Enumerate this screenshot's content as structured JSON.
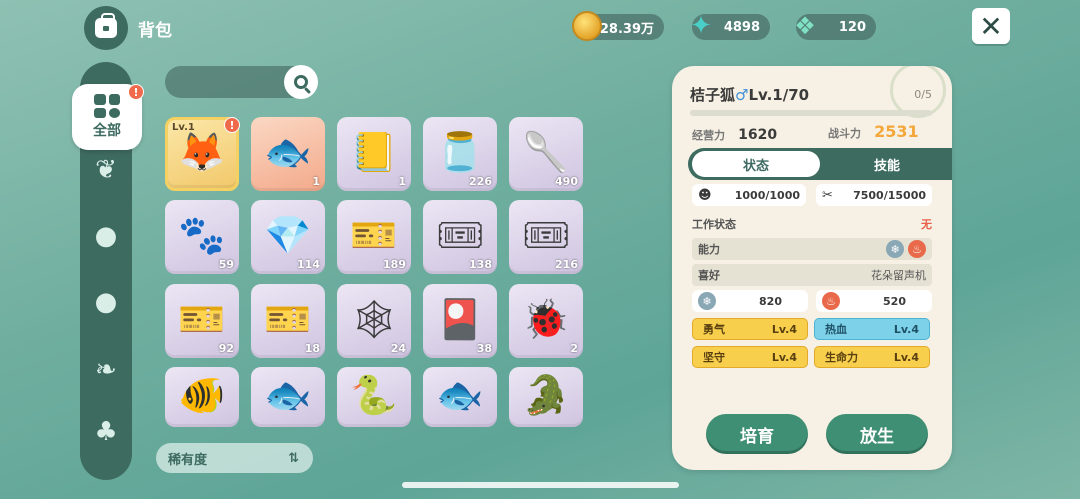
{
  "header": {
    "title": "背包",
    "currencies": [
      {
        "icon": "gold-coin-icon",
        "value": "28.39万"
      },
      {
        "icon": "blue-star-icon",
        "value": "4898"
      },
      {
        "icon": "green-gem-icon",
        "value": "120"
      }
    ],
    "close_icon": "✕"
  },
  "sidebar": {
    "active_label": "全部",
    "badge": "!",
    "items": [
      {
        "name": "sprout-icon",
        "glyph": "🌱"
      },
      {
        "name": "round-creature-icon",
        "glyph": "●"
      },
      {
        "name": "round-creature-icon-2",
        "glyph": "●"
      },
      {
        "name": "leaf-icon",
        "glyph": "🍃"
      },
      {
        "name": "tree-icon",
        "glyph": "🌳"
      }
    ]
  },
  "search": {
    "placeholder": ""
  },
  "grid": {
    "items": [
      {
        "name": "orange-fox-pet",
        "count": "",
        "level": "Lv.1",
        "badge": "!",
        "glyph": "🦊",
        "style": "gold"
      },
      {
        "name": "blue-manta-ray",
        "count": "1",
        "glyph": "🐟",
        "style": "orange"
      },
      {
        "name": "notebook-box",
        "count": "1",
        "glyph": "📒",
        "style": ""
      },
      {
        "name": "glass-jar",
        "count": "226",
        "glyph": "🫙",
        "style": ""
      },
      {
        "name": "potion-spoon",
        "count": "490",
        "glyph": "🥄",
        "style": ""
      },
      {
        "name": "cat-paw-cushion",
        "count": "59",
        "glyph": "🐾",
        "style": ""
      },
      {
        "name": "green-crystal",
        "count": "114",
        "glyph": "💎",
        "style": ""
      },
      {
        "name": "ice-ticket",
        "count": "189",
        "glyph": "🎫",
        "style": ""
      },
      {
        "name": "pink-ticket-male",
        "count": "138",
        "glyph": "🎟",
        "style": ""
      },
      {
        "name": "pink-ticket",
        "count": "216",
        "glyph": "🎟",
        "style": ""
      },
      {
        "name": "purple-ticket-male",
        "count": "92",
        "glyph": "🎫",
        "style": ""
      },
      {
        "name": "purple-ticket",
        "count": "18",
        "glyph": "🎫",
        "style": ""
      },
      {
        "name": "wire-heart",
        "count": "24",
        "glyph": "🕸",
        "style": ""
      },
      {
        "name": "cat-card",
        "count": "38",
        "glyph": "🎴",
        "style": ""
      },
      {
        "name": "yellow-ladybug",
        "count": "2",
        "glyph": "🐞",
        "style": ""
      },
      {
        "name": "red-blue-fish",
        "count": "",
        "glyph": "🐠",
        "style": ""
      },
      {
        "name": "blue-carp",
        "count": "",
        "glyph": "🐟",
        "style": ""
      },
      {
        "name": "eel",
        "count": "",
        "glyph": "🐍",
        "style": ""
      },
      {
        "name": "rainbow-fish",
        "count": "",
        "glyph": "🐟",
        "style": ""
      },
      {
        "name": "sturgeon",
        "count": "",
        "glyph": "🐊",
        "style": ""
      }
    ]
  },
  "sort": {
    "label": "稀有度",
    "icon": "⇅"
  },
  "detail": {
    "name": "桔子狐",
    "gender": "♂",
    "level": "Lv.1/70",
    "slots": "0/5",
    "business_label": "经营力",
    "business_value": "1620",
    "combat_label": "战斗力",
    "combat_value": "2531",
    "tabs": [
      "状态",
      "技能"
    ],
    "hunger": "1000/1000",
    "stamina": "7500/15000",
    "work_status_label": "工作状态",
    "work_status_value": "无",
    "ability_label": "能力",
    "ability_icons": [
      {
        "type": "ice",
        "level": "2"
      },
      {
        "type": "fire",
        "level": "1"
      }
    ],
    "preference_label": "喜好",
    "preference_value": "花朵留声机",
    "ice_value": "820",
    "fire_value": "520",
    "traits": [
      {
        "name": "勇气",
        "level": "Lv.4",
        "color": "yellow"
      },
      {
        "name": "热血",
        "level": "Lv.4",
        "color": "blue"
      },
      {
        "name": "坚守",
        "level": "Lv.4",
        "color": "yellow"
      },
      {
        "name": "生命力",
        "level": "Lv.4",
        "color": "yellow"
      }
    ],
    "buttons": {
      "train": "培育",
      "release": "放生"
    }
  }
}
